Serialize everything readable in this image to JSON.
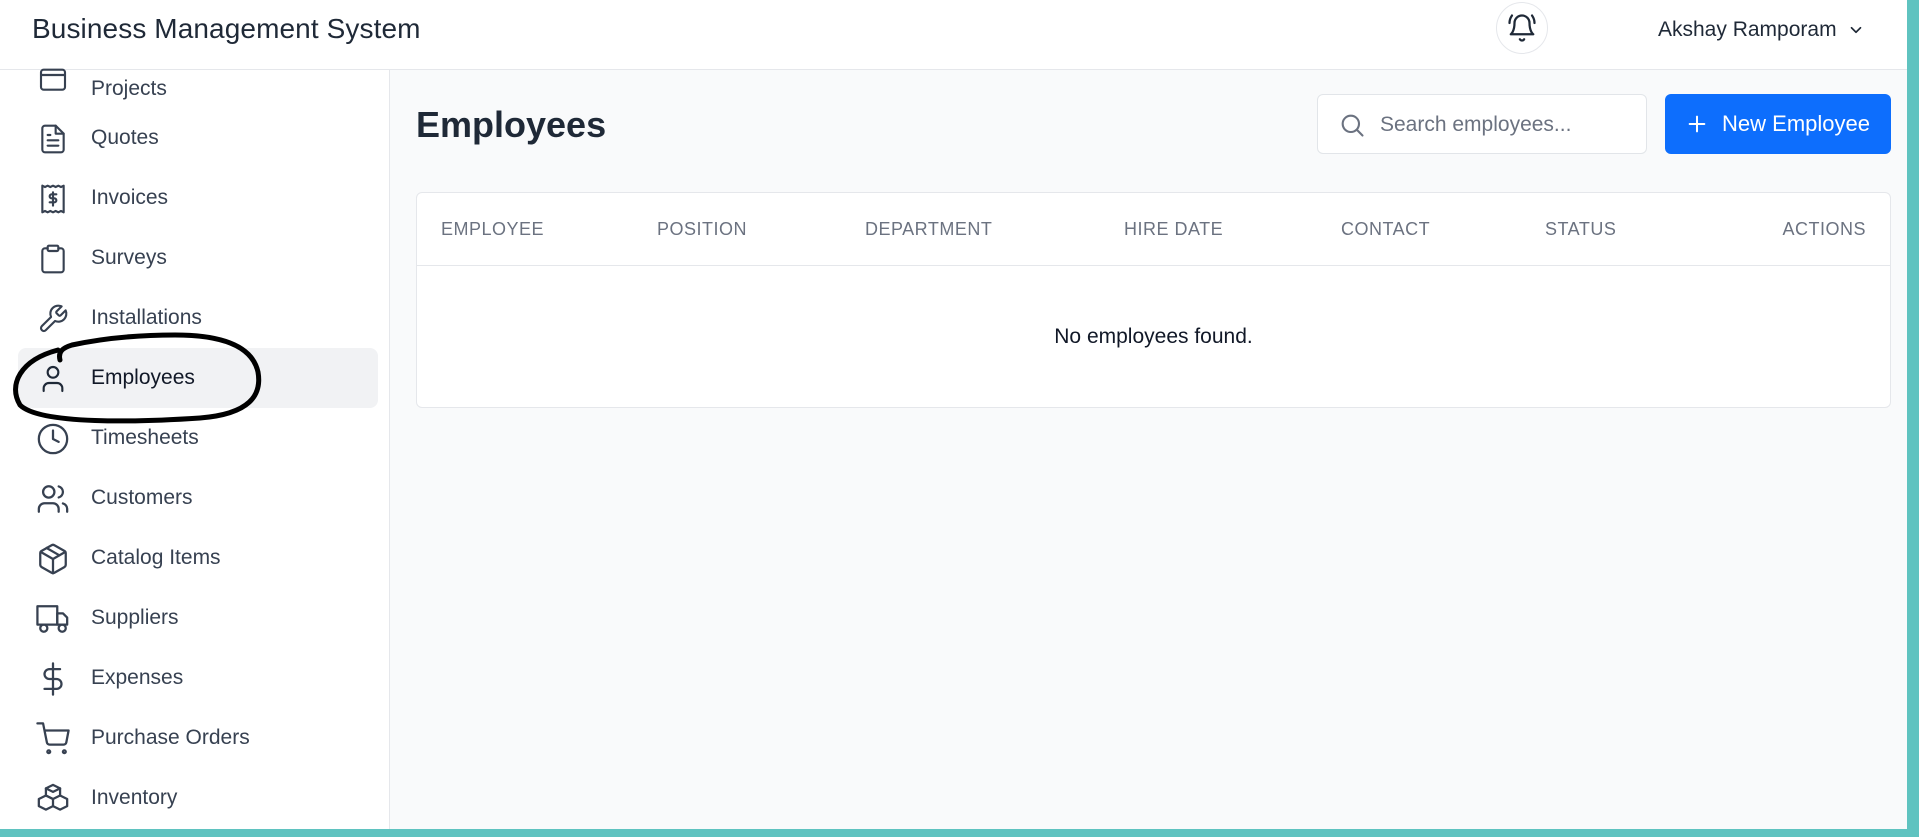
{
  "app": {
    "title": "Business Management System"
  },
  "header": {
    "notification_icon": "bell-ring-icon",
    "user_name": "Akshay Ramporam",
    "user_menu_icon": "chevron-down-icon"
  },
  "sidebar": {
    "items": [
      {
        "label": "Projects",
        "icon": "folder-icon"
      },
      {
        "label": "Quotes",
        "icon": "file-text-icon"
      },
      {
        "label": "Invoices",
        "icon": "receipt-icon"
      },
      {
        "label": "Surveys",
        "icon": "clipboard-icon"
      },
      {
        "label": "Installations",
        "icon": "wrench-icon"
      },
      {
        "label": "Employees",
        "icon": "user-icon",
        "active": true
      },
      {
        "label": "Timesheets",
        "icon": "clock-icon"
      },
      {
        "label": "Customers",
        "icon": "users-icon"
      },
      {
        "label": "Catalog Items",
        "icon": "package-icon"
      },
      {
        "label": "Suppliers",
        "icon": "truck-icon"
      },
      {
        "label": "Expenses",
        "icon": "dollar-sign-icon"
      },
      {
        "label": "Purchase Orders",
        "icon": "shopping-cart-icon"
      },
      {
        "label": "Inventory",
        "icon": "boxes-icon"
      }
    ]
  },
  "main": {
    "page_title": "Employees",
    "search": {
      "placeholder": "Search employees...",
      "value": ""
    },
    "new_button_label": "New Employee",
    "table": {
      "columns": [
        "EMPLOYEE",
        "POSITION",
        "DEPARTMENT",
        "HIRE DATE",
        "CONTACT",
        "STATUS",
        "ACTIONS"
      ],
      "rows": [],
      "empty_message": "No employees found."
    }
  },
  "colors": {
    "accent": "#0d6efd",
    "active_bg": "#f1f2f4",
    "window_border": "#5fc3c0"
  }
}
